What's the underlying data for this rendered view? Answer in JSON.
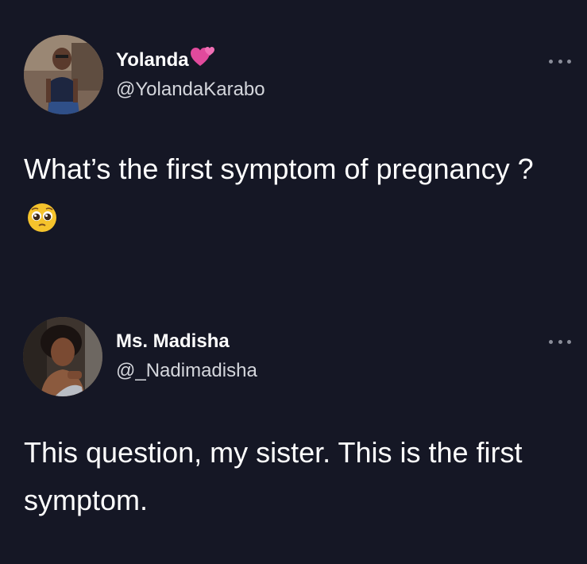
{
  "tweets": [
    {
      "display_name": "Yolanda",
      "name_emoji": "hearts-emoji-icon",
      "handle": "@YolandaKarabo",
      "text": "What’s the first symptom of pregnancy ?",
      "text_emoji": "pleading-face-emoji-icon",
      "menu_icon": "more-options-icon"
    },
    {
      "display_name": "Ms. Madisha",
      "handle": "@_Nadimadisha",
      "text": "This question, my sister. This is the first symptom.",
      "menu_icon": "more-options-icon"
    }
  ],
  "colors": {
    "background": "#151725",
    "text_primary": "#ffffff",
    "text_secondary": "#d4d6dc",
    "icon_muted": "#8a8d99",
    "heart": "#e14a9c",
    "emoji": "#f5c32c"
  }
}
